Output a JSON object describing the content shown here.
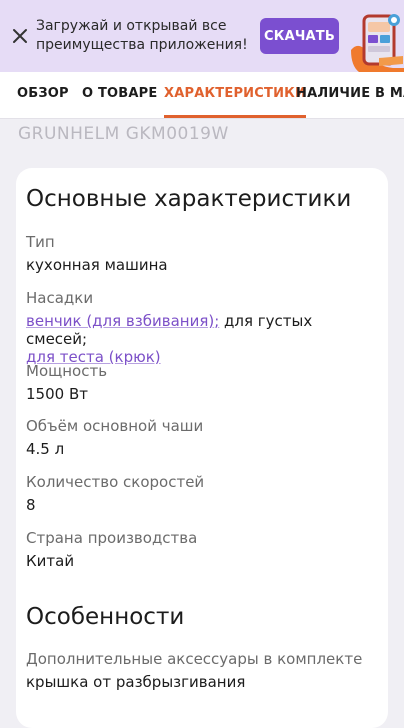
{
  "banner": {
    "message": "Загружай и открывай все преимущества приложения!",
    "cta_label": "СКАЧАТЬ"
  },
  "tabs": [
    {
      "label": "ОБЗОР",
      "active": false
    },
    {
      "label": "О ТОВАРЕ",
      "active": false
    },
    {
      "label": "ХАРАКТЕРИСТИКИ",
      "active": true
    },
    {
      "label": "НАЛИЧИЕ В МАГАЗ",
      "active": false
    }
  ],
  "product": {
    "model": "GRUNHELM GKM0019W"
  },
  "main_section": {
    "title": "Основные характеристики",
    "specs": [
      {
        "label": "Тип",
        "value": "кухонная машина"
      },
      {
        "label": "Насадки",
        "links": [
          "венчик (для взбивания)",
          "для теста (крюк)"
        ],
        "separator": ";",
        "plain": "для густых смесей;"
      },
      {
        "label": "Мощность",
        "value": "1500 Вт"
      },
      {
        "label": "Объём основной чаши",
        "value": "4.5 л"
      },
      {
        "label": "Количество скоростей",
        "value": "8"
      },
      {
        "label": "Страна производства",
        "value": "Китай"
      }
    ]
  },
  "features_section": {
    "title": "Особенности",
    "specs": [
      {
        "label": "Дополнительные аксессуары в комплекте",
        "value": "крышка от разбрызгивания"
      }
    ]
  },
  "colors": {
    "accent": "#e0612e",
    "brand": "#7b4fd0",
    "link": "#7c50c8"
  },
  "icons": {
    "close": "close-icon",
    "app_promo": "phone-promo-icon"
  }
}
